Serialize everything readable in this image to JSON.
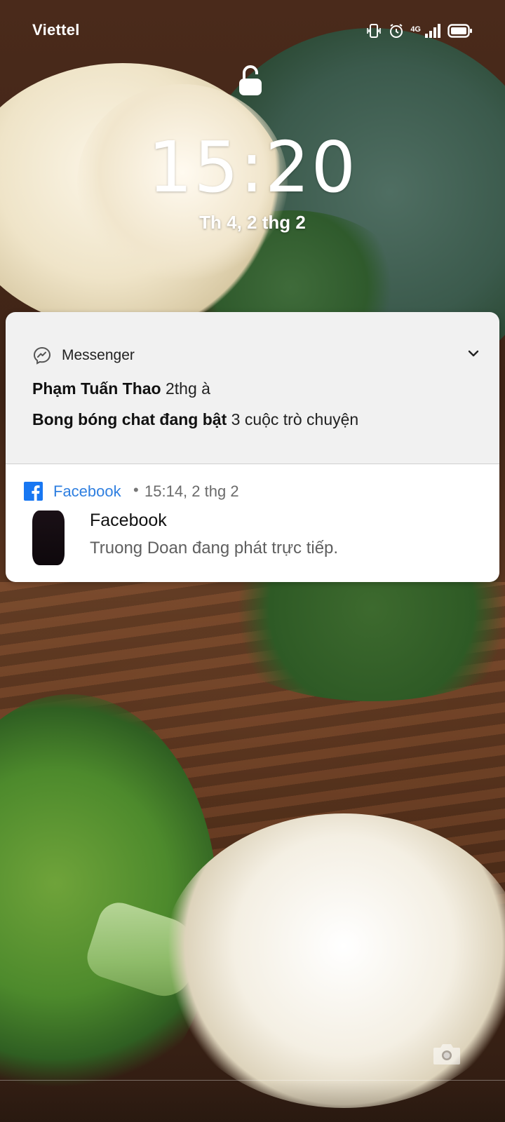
{
  "status_bar": {
    "carrier": "Viettel",
    "network": "4G",
    "icons": [
      "vibrate-icon",
      "alarm-icon",
      "signal-4g-icon",
      "battery-icon"
    ]
  },
  "lock_screen": {
    "lock_icon": "lock-open-icon",
    "time": "15:20",
    "date": "Th 4, 2 thg 2"
  },
  "notifications": [
    {
      "app": "Messenger",
      "icon": "messenger-icon",
      "expand_icon": "chevron-down-icon",
      "lines": [
        {
          "bold": "Phạm Tuấn Thao",
          "text": "2thg à"
        },
        {
          "bold": "Bong bóng chat đang bật",
          "text": "3 cuộc trò chuyện"
        }
      ]
    },
    {
      "app": "Facebook",
      "icon": "facebook-icon",
      "separator": "•",
      "time": "15:14, 2 thg 2",
      "title": "Facebook",
      "text": "Truong Doan đang phát trực tiếp."
    }
  ],
  "shortcuts": {
    "camera_icon": "camera-icon"
  },
  "colors": {
    "facebook_blue": "#1877f2",
    "link_blue": "#2f7fe0",
    "notification_bg": "#f1f1f1"
  }
}
